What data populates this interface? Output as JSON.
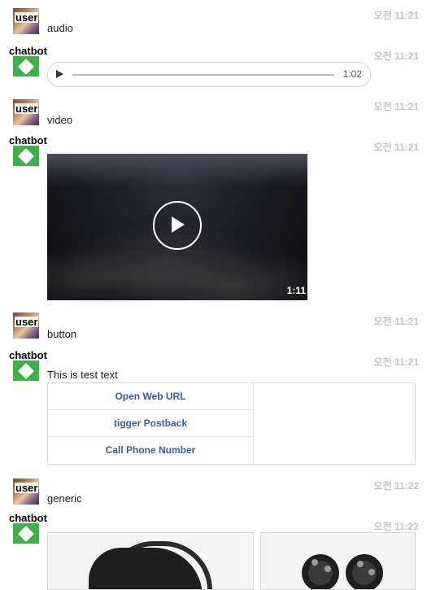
{
  "messages": [
    {
      "sender": "user",
      "avatar_label": "user",
      "time": "오전 11:21",
      "text": "audio"
    },
    {
      "sender": "chatbot",
      "avatar_label": "chatbot",
      "time": "오전 11:21",
      "audio": {
        "duration": "1:02",
        "progress": 0
      }
    },
    {
      "sender": "user",
      "avatar_label": "user",
      "time": "오전 11:21",
      "text": "video"
    },
    {
      "sender": "chatbot",
      "avatar_label": "chatbot",
      "time": "오전 11:21",
      "video": {
        "duration": "1:11"
      }
    },
    {
      "sender": "user",
      "avatar_label": "user",
      "time": "오전 11:21",
      "text": "button"
    },
    {
      "sender": "chatbot",
      "avatar_label": "chatbot",
      "time": "오전 11:21",
      "text": "This is test text",
      "buttons": [
        "Open Web URL",
        "tigger Postback",
        "Call Phone Number"
      ]
    },
    {
      "sender": "user",
      "avatar_label": "user",
      "time": "오전 11:22",
      "text": "generic"
    },
    {
      "sender": "chatbot",
      "avatar_label": "chatbot",
      "time": "오전 11:22",
      "generic": {
        "cards": [
          "vr-headset-image",
          "vr-controllers-image"
        ]
      }
    }
  ],
  "colors": {
    "bot_avatar": "#3fb14a",
    "button_text": "#3a5a96",
    "timestamp": "#c2c2c2"
  },
  "icons": {
    "play": "play-icon",
    "play_circle": "play-circle-icon"
  }
}
